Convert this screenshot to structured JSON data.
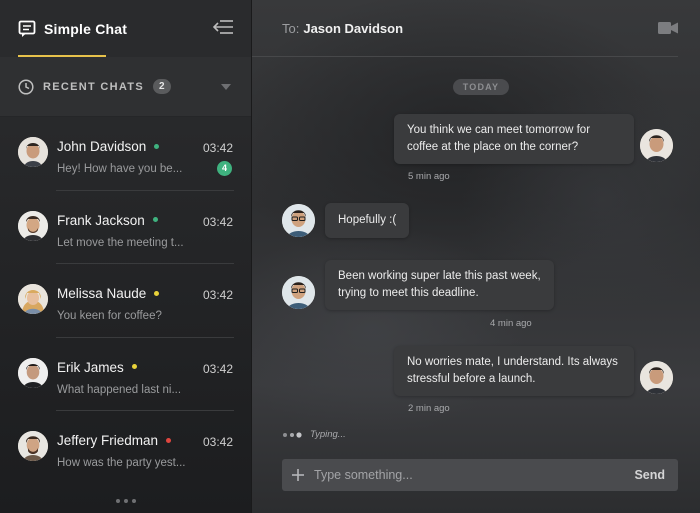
{
  "app": {
    "title": "Simple Chat",
    "accent_color": "#e7c24b"
  },
  "sidebar": {
    "recent_label": "RECENT CHATS",
    "recent_count": "2",
    "chats": [
      {
        "name": "John Davidson",
        "time": "03:42",
        "preview": "Hey! How have you be...",
        "status_color": "#3fb27f",
        "unread": "4"
      },
      {
        "name": "Frank Jackson",
        "time": "03:42",
        "preview": "Let move the meeting t...",
        "status_color": "#3fb27f"
      },
      {
        "name": "Melissa Naude",
        "time": "03:42",
        "preview": "You keen for coffee?",
        "status_color": "#e8d23a"
      },
      {
        "name": "Erik James",
        "time": "03:42",
        "preview": "What happened last ni...",
        "status_color": "#e8d23a"
      },
      {
        "name": "Jeffery Friedman",
        "time": "03:42",
        "preview": "How was the party yest...",
        "status_color": "#e0463f"
      }
    ]
  },
  "conversation": {
    "to_label": "To:",
    "to_name": "Jason Davidson",
    "date_divider": "TODAY",
    "messages": [
      {
        "side": "right",
        "text": "You think we can meet tomorrow for coffee at the place on the corner?",
        "time": "5 min ago"
      },
      {
        "side": "left",
        "text": "Hopefully :("
      },
      {
        "side": "left",
        "text": "Been working super late this past week, trying to meet this deadline.",
        "time": "4 min ago"
      },
      {
        "side": "right",
        "text": "No worries mate, I understand. Its always stressful before a launch.",
        "time": "2 min ago"
      }
    ],
    "typing_text": "Typing..."
  },
  "composer": {
    "placeholder": "Type something...",
    "send_label": "Send"
  },
  "icons": {
    "logo": "chat-bubble-icon",
    "collapse": "collapse-sidebar-icon",
    "recent": "clock-icon",
    "caret": "chevron-down-icon",
    "video": "video-camera-icon",
    "add": "plus-icon"
  }
}
